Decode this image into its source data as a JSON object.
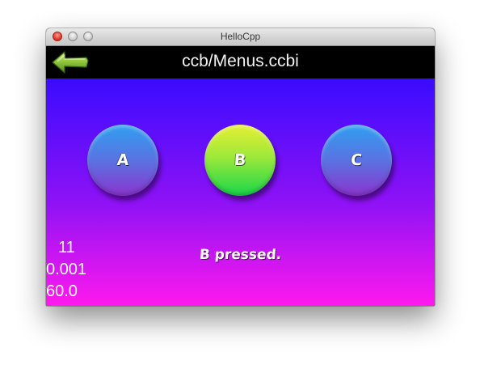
{
  "window": {
    "title": "HelloCpp"
  },
  "header": {
    "scene_title": "ccb/Menus.ccbi",
    "back_icon": "back-arrow-icon"
  },
  "menu": {
    "buttons": [
      {
        "label": "A",
        "color": "#4a7fe6"
      },
      {
        "label": "B",
        "color": "#7fe63c"
      },
      {
        "label": "C",
        "color": "#4a7fe6"
      }
    ],
    "status": "B pressed."
  },
  "stats": {
    "draw_calls": "11",
    "seconds_per_frame": "0.001",
    "fps": "60.0"
  },
  "colors": {
    "background_top": "#3a0bff",
    "background_bottom": "#ff19ee",
    "header_bar": "#000000"
  }
}
